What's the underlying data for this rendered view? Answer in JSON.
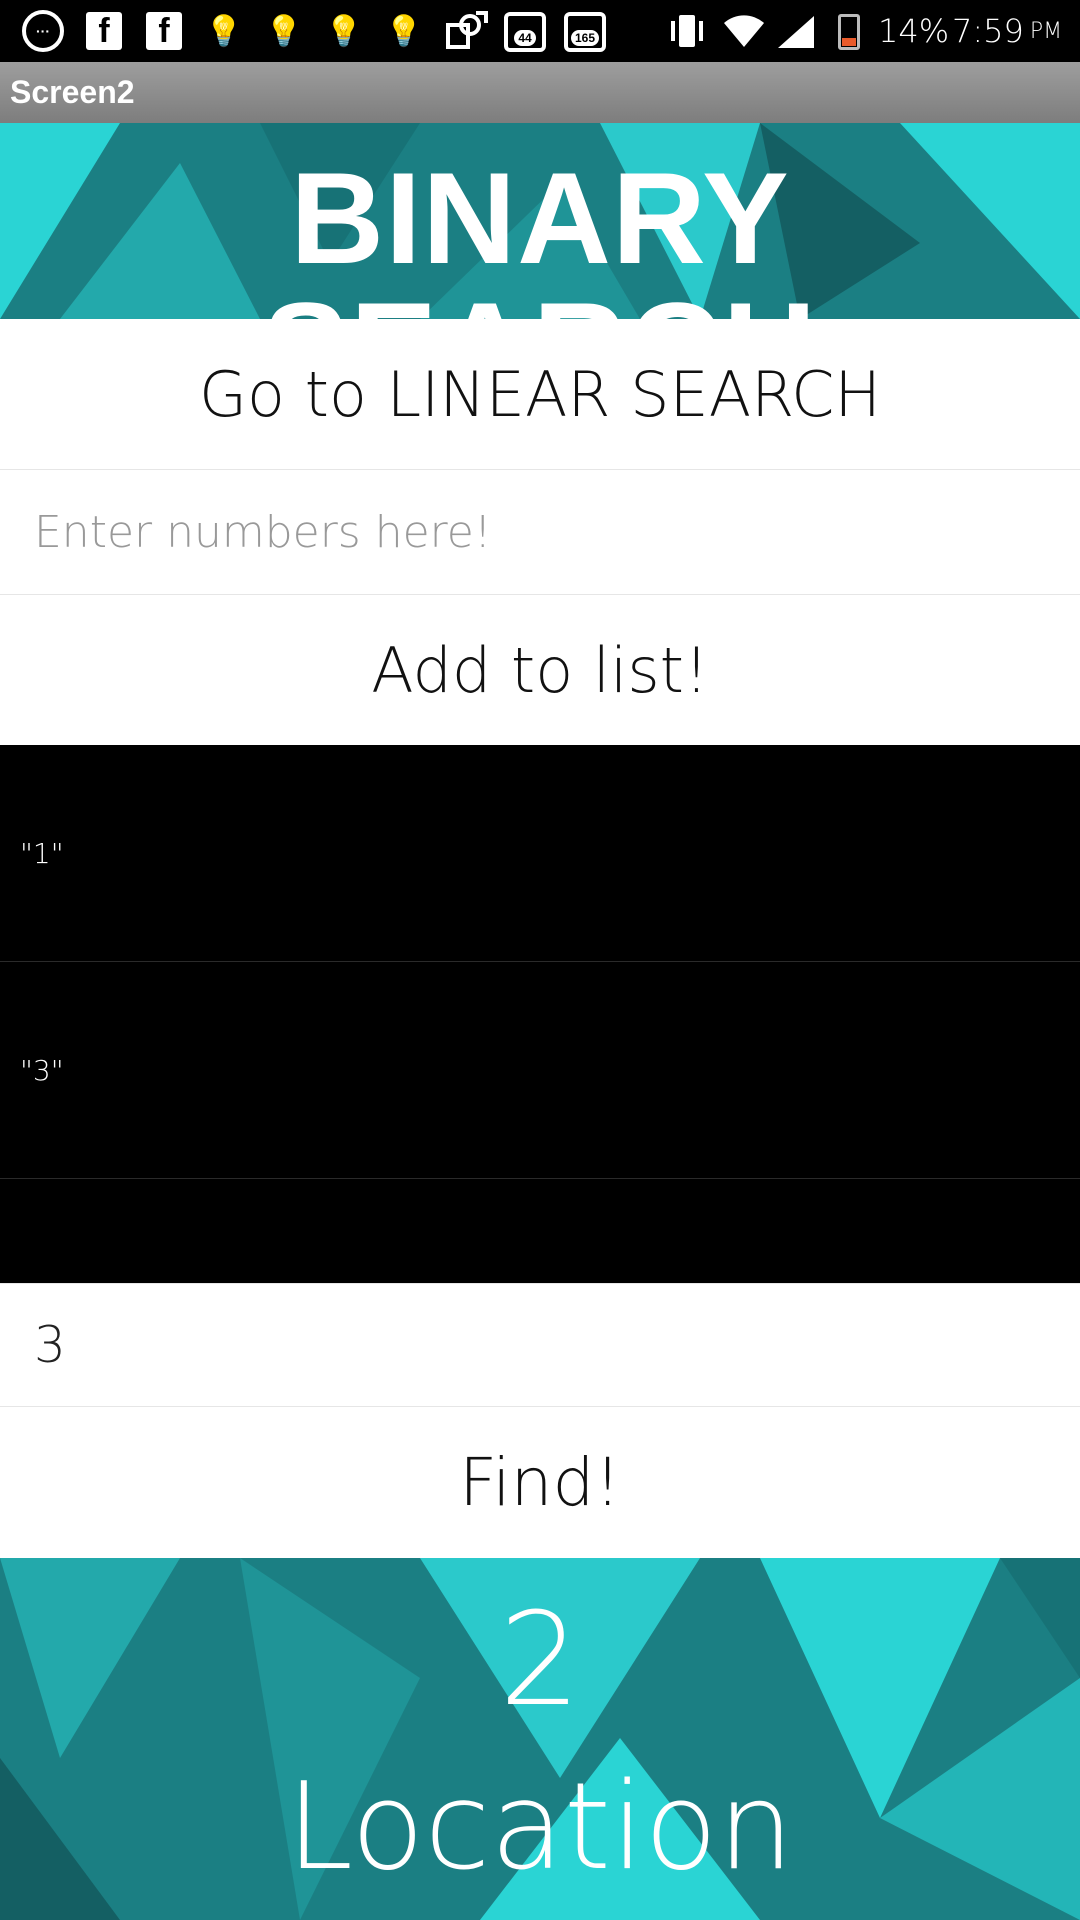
{
  "status_bar": {
    "battery": "14%",
    "time": "7:59",
    "ampm": "PM",
    "badges": [
      "44",
      "165"
    ],
    "fb_glyph": "f",
    "bulb_glyph": "💡",
    "vibrate_glyph": "▮",
    "wifi_glyph": "◔",
    "icons": [
      "app-circle-icon",
      "facebook-icon",
      "facebook-icon",
      "lightbulb-icon",
      "lightbulb-icon",
      "lightbulb-icon",
      "lightbulb-icon",
      "screenshot-icon",
      "cat-mail-icon",
      "cat-mail-icon",
      "vibrate-icon",
      "wifi-icon",
      "signal-icon",
      "battery-icon"
    ],
    "battery_color": "#e85a2a"
  },
  "action_bar": {
    "title": "Screen2"
  },
  "header": {
    "title": "BINARY SEARCH"
  },
  "buttons": {
    "linear": "Go to LINEAR SEARCH",
    "add": "Add to list!",
    "find": "Find!"
  },
  "inputs": {
    "numbers_placeholder": "Enter numbers here!",
    "search_value": "3"
  },
  "list": {
    "items": [
      "\"1\"",
      "\"3\""
    ]
  },
  "result": {
    "number": "2",
    "label": "Location"
  },
  "colors": {
    "teal": "#1b7f83",
    "teal_light": "#2ad4d4",
    "white": "#ffffff",
    "black": "#000000"
  }
}
